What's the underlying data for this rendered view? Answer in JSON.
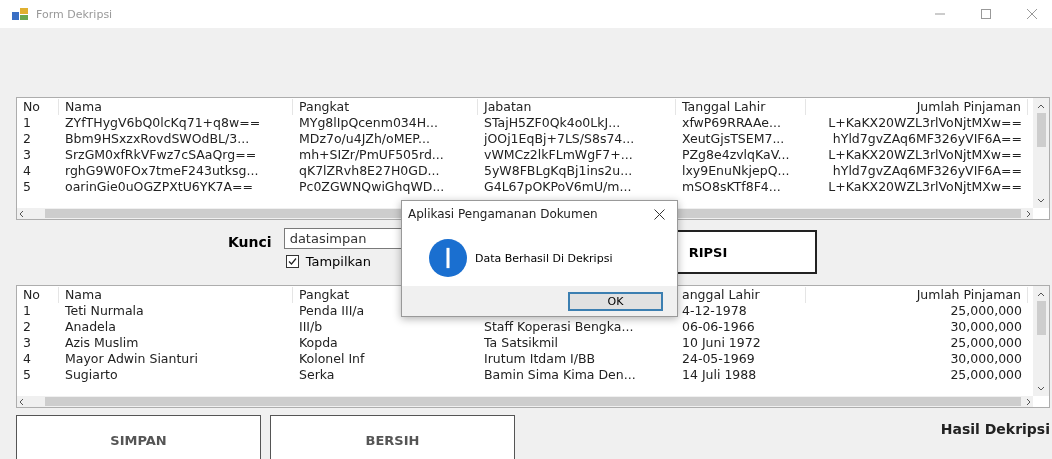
{
  "window": {
    "title": "Form Dekripsi"
  },
  "encrypted_table": {
    "columns": [
      "No",
      "Nama",
      "Pangkat",
      "Jabatan",
      "Tanggal Lahir",
      "Jumlah Pinjaman"
    ],
    "rows": [
      [
        "1",
        "ZYfTHygV6bQ0lcKq71+q8w==",
        "MYg8lIpQcenm034H...",
        "STajH5ZF0Qk4o0LkJ...",
        "xfwP69RRAAe...",
        "L+KaKX20WZL3rlVoNjtMXw=="
      ],
      [
        "2",
        "Bbm9HSxzxRovdSWOdBL/3...",
        "MDz7o/u4JZh/oMEP...",
        "jOOj1EqBj+7LS/S8s74...",
        "XeutGjsTSEM7...",
        "hYld7gvZAq6MF326yVIF6A=="
      ],
      [
        "3",
        "SrzGM0xfRkVFwz7cSAaQrg==",
        "mh+SIZr/PmUF505rd...",
        "vWMCz2lkFLmWgF7+...",
        "PZg8e4zvlqKaV...",
        "L+KaKX20WZL3rlVoNjtMXw=="
      ],
      [
        "4",
        "rghG9W0FOx7tmeF243utksg...",
        "qK7lZRvh8E27H0GD...",
        "5yW8FBLgKqBj1ins2u...",
        "lxy9EnuNkjepQ...",
        "hYld7gvZAq6MF326yVIF6A=="
      ],
      [
        "5",
        "oarinGie0uOGZPXtU6YK7A==",
        "Pc0ZGWNQwiGhqWD...",
        "G4L67pOKPoV6mU/m...",
        "mSO8sKTf8F4...",
        "L+KaKX20WZL3rlVoNjtMXw=="
      ]
    ]
  },
  "key_label": "Kunci",
  "key_field": {
    "value": "datasimpan"
  },
  "show_checkbox": {
    "label": "Tampilkan",
    "checked": true
  },
  "decrypt_button": "RIPSI",
  "decrypted_table": {
    "columns": [
      "No",
      "Nama",
      "Pangkat",
      null,
      "anggal Lahir",
      "Jumlah Pinjaman"
    ],
    "rows": [
      [
        "1",
        "Teti Nurmala",
        "Penda III/a",
        null,
        "4-12-1978",
        "25,000,000"
      ],
      [
        "2",
        "Anadela",
        "III/b",
        "Staff Koperasi Bengka...",
        "06-06-1966",
        "30,000,000"
      ],
      [
        "3",
        "Azis Muslim",
        "Kopda",
        "Ta Satsikmil",
        "10 Juni 1972",
        "25,000,000"
      ],
      [
        "4",
        "Mayor Adwin Sianturi",
        "Kolonel Inf",
        "Irutum Itdam I/BB",
        "24-05-1969",
        "30,000,000"
      ],
      [
        "5",
        "Sugiarto",
        "Serka",
        "Bamin Sima Kima Den...",
        "14 Juli 1988",
        "25,000,000"
      ]
    ]
  },
  "buttons": [
    "SIMPAN",
    "BERSIH"
  ],
  "result_label": "Hasil Dekripsi",
  "dialog": {
    "title": "Aplikasi Pengamanan Dokumen",
    "message": "Data Berhasil Di Dekripsi",
    "button": "OK"
  }
}
